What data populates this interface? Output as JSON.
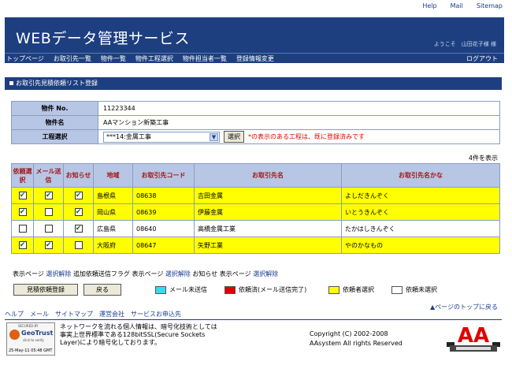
{
  "top_links": [
    "Help",
    "Mail",
    "Sitemap"
  ],
  "app": {
    "title": "WEBデータ管理サービス",
    "user": "ようこそ　山田花子様 様",
    "logout": "ログアウト"
  },
  "nav": [
    "トップページ",
    "お取引先一覧",
    "物件一覧",
    "物件工程選択",
    "物件担当者一覧",
    "登録情報変更"
  ],
  "section_title": "お取引先見積依頼リスト登録",
  "form": {
    "property_no_label": "物件 No.",
    "property_no": "11223344",
    "property_name_label": "物件名",
    "property_name": "AAマンション新築工事",
    "process_label": "工程選択",
    "process_value": "***14:金属工事",
    "select_button": "選択",
    "note": "*の表示のある工程は、既に登録済みです"
  },
  "count": "4件を表示",
  "table": {
    "headers": [
      "依頼選択",
      "メール送信",
      "お知らせ",
      "地域",
      "お取引先コード",
      "お取引先名",
      "お取引先名かな"
    ],
    "rows": [
      {
        "irai": true,
        "mail": true,
        "notice": true,
        "region": "島根県",
        "code": "08638",
        "name": "吉田金属",
        "kana": "よしだきんぞく",
        "highlight": "#ffff00"
      },
      {
        "irai": true,
        "mail": false,
        "notice": true,
        "region": "岡山県",
        "code": "08639",
        "name": "伊藤金属",
        "kana": "いとうきんぞく",
        "highlight": "#ffff00"
      },
      {
        "irai": false,
        "mail": false,
        "notice": true,
        "region": "広島県",
        "code": "08640",
        "name": "高橋金属工業",
        "kana": "たかはしきんぞく",
        "highlight": "#ffffff"
      },
      {
        "irai": true,
        "mail": true,
        "notice": false,
        "region": "大阪府",
        "code": "08647",
        "name": "矢野工業",
        "kana": "やのかなもの",
        "highlight": "#ffff00"
      }
    ]
  },
  "actions": {
    "label1": "表示ページ",
    "all1": "選択",
    "clear1": "解除",
    "label2": "追加依頼送信フラグ 表示ページ",
    "all2": "選択",
    "clear2": "解除",
    "label3": "お知らせ 表示ページ",
    "all3": "選択",
    "clear3": "解除"
  },
  "buttons": {
    "register": "見積依頼登録",
    "back": "戻る"
  },
  "legend": [
    {
      "color": "#33ddee",
      "label": "メール未送信"
    },
    {
      "color": "#e00000",
      "label": "依頼済(メール送信完了)"
    },
    {
      "color": "#ffff00",
      "label": "依頼者選択"
    },
    {
      "color": "#ffffff",
      "label": "依頼未選択"
    }
  ],
  "page_top": "▲ページのトップに戻る",
  "footer_links": [
    "ヘルプ",
    "メール",
    "サイトマップ",
    "運営会社",
    "サービスお申込先"
  ],
  "geotrust": {
    "secured_by": "SECURED BY",
    "name": "GeoTrust",
    "click": "click to verify",
    "date": "25-May-11 05:48 GMT"
  },
  "ssl_text": "ネットワークを流れる個人情報は、暗号化技術としては事実上世界標準である128bitSSL(Secure Sockets Layer)により暗号化しております。",
  "copyright": {
    "line1": "Copyright (C) 2002-2008",
    "line2": "AAsystem All rights Reserved"
  },
  "logo_text": "AA"
}
